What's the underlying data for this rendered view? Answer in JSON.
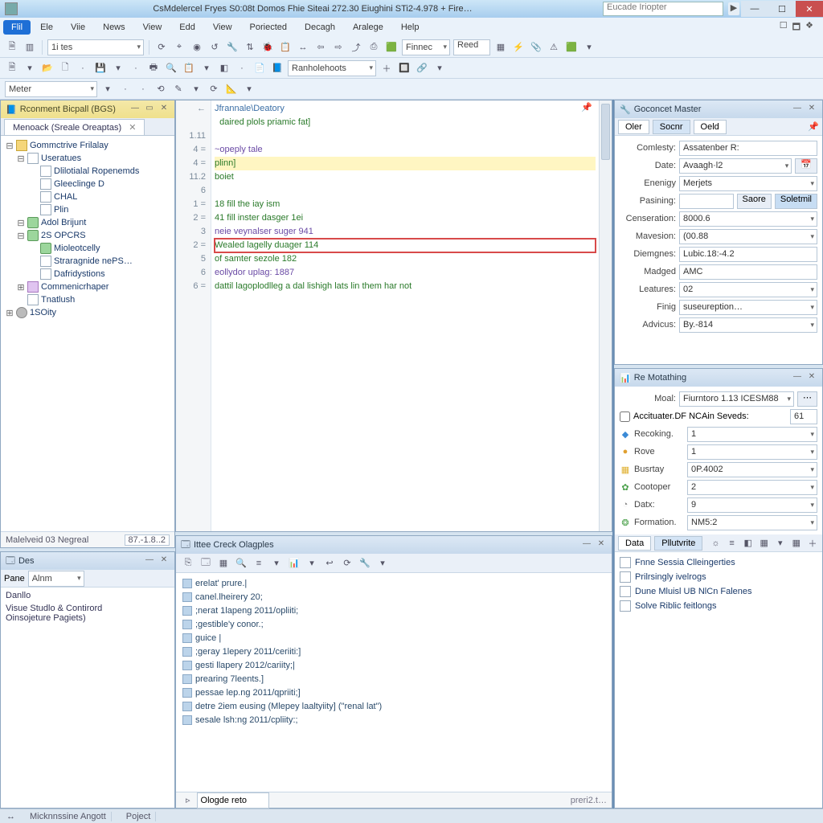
{
  "colors": {
    "accent": "#1e6fd6",
    "highlightRed": "#d84a4a",
    "highlightYellow": "#fff6c2"
  },
  "titlebar": {
    "title": "CsMdelercel Fryes S0:08t Domos Fhie Siteai 272.30 Eiughini STi2-4.978 + Fire…",
    "search_placeholder": "Eucade Iriopter",
    "play_glyph": "▶"
  },
  "window_controls": {
    "min": "—",
    "max": "☐",
    "close": "✕",
    "aux1": "☐",
    "aux2": "🗖",
    "aux3": "❖"
  },
  "menu": [
    "Flil",
    "Ele",
    "Viie",
    "News",
    "View",
    "Edd",
    "View",
    "Poriected",
    "Decagh",
    "Aralege",
    "Help"
  ],
  "toolbar1": {
    "icons": [
      "🗎",
      "▥",
      "▾",
      "",
      "",
      "",
      "",
      ""
    ],
    "dropdown1": "1i tes",
    "icons_mid": [
      "⟳",
      "⌖",
      "◉",
      "↺",
      "🔧",
      "⇅",
      "🐞",
      "📋",
      "↔",
      "⇦",
      "⇨",
      "⤴",
      "⎙",
      "🟩"
    ],
    "finnec": "Finnec",
    "reed": "Reed",
    "tail_icons": [
      "▦",
      "⚡",
      "📎",
      "⚠",
      "🟩",
      "▾"
    ]
  },
  "toolbar2": {
    "icons_a": [
      "🗎",
      "▾",
      "📂",
      "🗋",
      "",
      "💾",
      "▾",
      "",
      "🖶",
      "🔍",
      "📋",
      "▾",
      "◧",
      "",
      "📄",
      "📘"
    ],
    "dropdown": "Ranholehoots",
    "icons_b": [
      "＋",
      "🔲",
      "🔗",
      "▾"
    ]
  },
  "toolbar3": {
    "dropdown": "Meter",
    "icons": [
      "▾",
      "",
      "",
      "⟲",
      "✎",
      "▾",
      "⟳",
      "📐",
      "▾"
    ]
  },
  "left_panel": {
    "title": "Rconment Bicpall (BGS)",
    "tab": "Menoack (Sreale Oreaptas)",
    "tree": [
      {
        "d": 0,
        "tw": "⊟",
        "ic": "ic-folder",
        "t": "Gommctrive Frilalay"
      },
      {
        "d": 1,
        "tw": "⊟",
        "ic": "ic-page",
        "t": "Useratues"
      },
      {
        "d": 2,
        "tw": "",
        "ic": "ic-page",
        "t": "Dlilotialal Ropenemds"
      },
      {
        "d": 2,
        "tw": "",
        "ic": "ic-page",
        "t": "Gleeclinge D"
      },
      {
        "d": 2,
        "tw": "",
        "ic": "ic-page",
        "t": "CHAL"
      },
      {
        "d": 2,
        "tw": "",
        "ic": "ic-page",
        "t": "Plin"
      },
      {
        "d": 1,
        "tw": "⊟",
        "ic": "ic-db",
        "t": "Adol Brijunt"
      },
      {
        "d": 1,
        "tw": "⊟",
        "ic": "ic-db",
        "t": "2S OPCRS"
      },
      {
        "d": 2,
        "tw": "",
        "ic": "ic-db",
        "t": "Mioleotcelly"
      },
      {
        "d": 2,
        "tw": "",
        "ic": "ic-page",
        "t": "Straragnide nePS…"
      },
      {
        "d": 2,
        "tw": "",
        "ic": "ic-page",
        "t": "Dafridystions"
      },
      {
        "d": 1,
        "tw": "⊞",
        "ic": "ic-mod",
        "t": "Commenicrhaper"
      },
      {
        "d": 1,
        "tw": "",
        "ic": "ic-page",
        "t": "Tnatlush"
      },
      {
        "d": 0,
        "tw": "⊞",
        "ic": "ic-gear",
        "t": "1SOity"
      }
    ]
  },
  "editor": {
    "controls": {
      "min": "—",
      "dock": "▭",
      "close": "✕",
      "pin": "📌",
      "arrow": "▾"
    },
    "gutter": [
      "←",
      "",
      "1.11",
      "4 =",
      "4 =",
      "11.2",
      "6",
      "1 =",
      "2 =",
      "3",
      "2 =",
      "5",
      "6",
      "6 ="
    ],
    "lines": [
      {
        "cls": "sx-path",
        "t": "Jfrannale\\Deatory"
      },
      {
        "cls": "sx-key",
        "t": "  daired plols priamic fat]"
      },
      {
        "cls": "",
        "t": ""
      },
      {
        "cls": "sx-str",
        "t": "~opeply tale"
      },
      {
        "cls": "sx-key hl-yellow",
        "t": "plinn]"
      },
      {
        "cls": "sx-key",
        "t": "boiet"
      },
      {
        "cls": "",
        "t": ""
      },
      {
        "cls": "sx-key",
        "t": "18 fill the iay ism"
      },
      {
        "cls": "sx-key",
        "t": "41 fill inster dasger 1ei"
      },
      {
        "cls": "sx-str",
        "t": "neie veynalser suger 941"
      },
      {
        "cls": "sx-key hl-redbox",
        "t": "Wealed lagelly duager 114"
      },
      {
        "cls": "sx-key",
        "t": "of samter sezole 182"
      },
      {
        "cls": "sx-str",
        "t": "eollydor uplag: 1887"
      },
      {
        "cls": "sx-key",
        "t": "dattil lagoplodlleg a dal lishigh lats lin them har not"
      }
    ],
    "ministatus_left": "Malelveid 03 Negreal",
    "ministatus_right": "87.-1.8..2"
  },
  "output": {
    "title": "Ittee Creck Olagples",
    "toolbar_icons": [
      "⎘",
      "🗔",
      "▦",
      "🔍",
      "≡",
      "▾",
      "📊",
      "▾",
      "↩",
      "⟳",
      "🔧",
      "▾"
    ],
    "lines": [
      "erelat' prure.|",
      "canel.lheirery 20;",
      ";nerat 1lapeng 2011/opliiti;",
      ";gestible'y conor.;",
      "guice |",
      ";geray 1lepery 2011/ceriiti:]",
      "gesti llapery 2012/cariity;|",
      " prearing 7leents.]",
      " pessae lep.ng 2011/qpriiti;]",
      " detre 2iem eusing (Mlepey laaltyiity] (\"renal lat\")",
      " sesale lsh:ng 2011/cpliity:;"
    ],
    "footer_label": "Poject",
    "footer_input": "Ologde reto",
    "footer_right": "preri2.t…"
  },
  "des_panel": {
    "title": "Des",
    "pane_label": "Pane",
    "pane_value": "Alnm",
    "lines": [
      "Danllo",
      "Visue Studlo & Contirord",
      "Oinsojeture Pagiets)"
    ]
  },
  "right_panel1": {
    "title": "Goconcet Master",
    "tabs": [
      "Oler",
      "Socnr",
      "Oeld"
    ],
    "active_tab": 1,
    "rows": [
      {
        "label": "Comlesty:",
        "value": "Assatenber R:",
        "drop": false
      },
      {
        "label": "Date:",
        "value": "Avaagh·l2",
        "drop": true,
        "cal": true
      },
      {
        "label": "Enenigy",
        "value": "Merjets",
        "drop": true
      },
      {
        "label": "Pasining:",
        "value": "",
        "btn1": "Saore",
        "btn2": "Soletmil"
      },
      {
        "label": "Censeration:",
        "value": "8000.6",
        "drop": true
      },
      {
        "label": "Mavesion:",
        "value": "(00.88",
        "drop": true
      },
      {
        "label": "Diemgnes:",
        "value": "Lubic.18:-4.2"
      },
      {
        "label": "Madged",
        "value": "AMC"
      },
      {
        "label": "Leatures:",
        "value": "02",
        "drop": true
      },
      {
        "label": "Finig",
        "value": "suseureption…",
        "drop": true
      },
      {
        "label": "Advicus:",
        "value": "By.-814",
        "drop": true
      }
    ]
  },
  "right_panel2": {
    "title": "Re Motathing",
    "model_label": "Moal:",
    "model_value": "Fiurntoro 1.13 ICESM88",
    "check_label": "Accituater.DF NCAin Seveds:",
    "check_value": "61",
    "rows": [
      {
        "ic": "◆",
        "c": "#3a8ad6",
        "label": "Recoking.",
        "value": "1"
      },
      {
        "ic": "●",
        "c": "#e0a030",
        "label": "Rove",
        "value": "1"
      },
      {
        "ic": "▦",
        "c": "#e0b030",
        "label": "Busrtay",
        "value": "0P.4002"
      },
      {
        "ic": "✿",
        "c": "#4aa04a",
        "label": "Cootoper",
        "value": "2"
      },
      {
        "ic": "◔",
        "c": "#888",
        "label": "Datx:",
        "value": "9"
      },
      {
        "ic": "❂",
        "c": "#4aa04a",
        "label": "Formation.",
        "value": "NM5:2"
      }
    ],
    "tabbar": [
      "Data",
      "Pllutvrite"
    ],
    "tabbar_active": 1,
    "tabbar_icons": [
      "☼",
      "≡",
      "◧",
      "▦",
      "▾",
      "▦",
      "＋"
    ],
    "list": [
      "Fnne Sessia Clleingerties",
      "Prilrsingly ivelrogs",
      "Dune Mluisl UB NlCn Falenes",
      "Solve Riblic feitlongs"
    ]
  },
  "status": {
    "left_arrow": "↔",
    "left": "Micknnssine Angott",
    "center": ""
  }
}
